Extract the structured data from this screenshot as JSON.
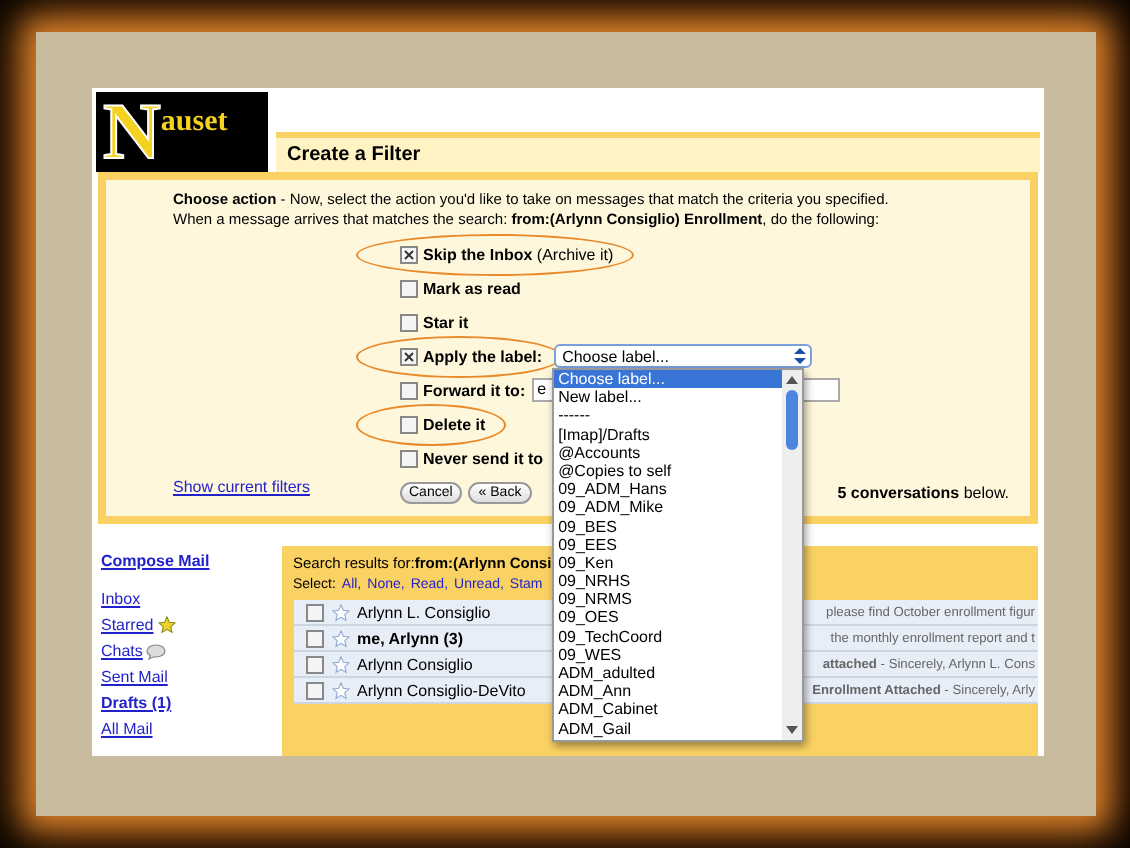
{
  "logo": {
    "initial": "N",
    "rest": "auset"
  },
  "page_title": "Create a Filter",
  "intro": {
    "lead": "Choose action",
    "text": " - Now, select the action you'd like to take on messages that match the criteria you specified.",
    "line2": "When a message arrives that matches the search: **from:(Arlynn Consiglio) Enrollment**, do the following:"
  },
  "actions": [
    {
      "kind": "plain",
      "label": "Skip the Inbox",
      "note": "(Archive it)",
      "checked": true,
      "circled": true
    },
    {
      "kind": "plain",
      "label": "Mark as read",
      "checked": false,
      "circled": false
    },
    {
      "kind": "plain",
      "label": "Star it",
      "checked": false,
      "circled": false
    },
    {
      "kind": "select",
      "label": "Apply the label:",
      "checked": true,
      "circled": true
    },
    {
      "kind": "input",
      "label": "Forward it to:",
      "value": "e",
      "checked": false,
      "circled": false
    },
    {
      "kind": "plain",
      "label": "Delete it",
      "checked": false,
      "circled": true
    },
    {
      "kind": "plain",
      "label": "Never send it to",
      "checked": false,
      "circled": false
    }
  ],
  "label_select": {
    "value": "Choose label...",
    "options": [
      {
        "label": "Choose label...",
        "selected": true
      },
      {
        "label": "New label...",
        "selected": false
      },
      {
        "label": "------",
        "selected": false
      },
      {
        "label": "[Imap]/Drafts",
        "selected": false
      },
      {
        "label": "@Accounts",
        "selected": false
      },
      {
        "label": "@Copies to self",
        "selected": false
      },
      {
        "label": "09_ADM_Hans",
        "selected": false
      },
      {
        "label": "09_ADM_Mike",
        "selected": false
      },
      {
        "label": "09_BES",
        "selected": false
      },
      {
        "label": "09_EES",
        "selected": false
      },
      {
        "label": "09_Ken",
        "selected": false
      },
      {
        "label": "09_NRHS",
        "selected": false
      },
      {
        "label": "09_NRMS",
        "selected": false
      },
      {
        "label": "09_OES",
        "selected": false
      },
      {
        "label": "09_TechCoord",
        "selected": false
      },
      {
        "label": "09_WES",
        "selected": false
      },
      {
        "label": "ADM_adulted",
        "selected": false
      },
      {
        "label": "ADM_Ann",
        "selected": false
      },
      {
        "label": "ADM_Cabinet",
        "selected": false
      },
      {
        "label": "ADM_Gail",
        "selected": false
      }
    ]
  },
  "buttons": [
    "Cancel",
    "« Back"
  ],
  "also_apply": "**5 conversations** below.",
  "show_filters": "Show current filters",
  "sidebar": [
    {
      "label": "Compose Mail",
      "kind": "compose"
    },
    {
      "label": "Inbox",
      "kind": "link"
    },
    {
      "label": "Starred",
      "kind": "star"
    },
    {
      "label": "Chats",
      "kind": "chat"
    },
    {
      "label": "Sent Mail",
      "kind": "link"
    },
    {
      "label": "Drafts (1)",
      "kind": "bold"
    },
    {
      "label": "All Mail",
      "kind": "link"
    }
  ],
  "results": {
    "prefix": "Search results for:",
    "query": "from:(Arlynn Consi",
    "select_label": "Select:",
    "select_links": [
      "All,",
      "None,",
      "Read,",
      "Unread,",
      "Stam"
    ],
    "rows": [
      {
        "sender": "Arlynn L. Consiglio",
        "snippet": "please find October enrollment figur",
        "unread": false,
        "checked": false
      },
      {
        "sender": "me, Arlynn (3)",
        "snippet": "the monthly enrollment report and t",
        "unread": true,
        "checked": false
      },
      {
        "sender": "Arlynn Consiglio",
        "snippet": "**attached** - Sincerely, Arlynn L. Cons",
        "unread": false,
        "checked": false
      },
      {
        "sender": "Arlynn Consiglio-DeVito",
        "snippet": "**Enrollment Attached** - Sincerely, Arly",
        "unread": false,
        "checked": false
      }
    ]
  }
}
